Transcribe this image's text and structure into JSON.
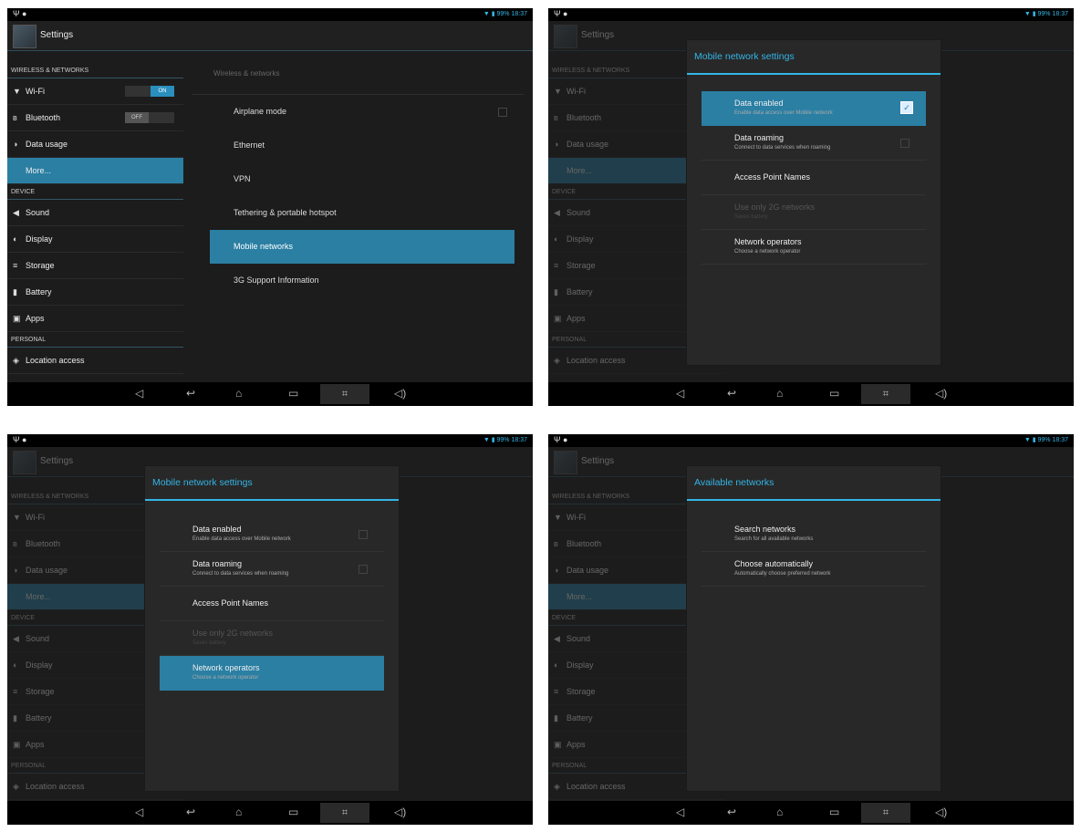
{
  "statusbar": {
    "left": "Ψ ●",
    "right": "▼ ▮ 99% 18:37"
  },
  "app_title": "Settings",
  "sidebar": {
    "cat_wireless": "WIRELESS & NETWORKS",
    "wifi": "Wi-Fi",
    "wifi_toggle": "ON",
    "bluetooth": "Bluetooth",
    "bluetooth_toggle": "OFF",
    "data_usage": "Data usage",
    "more": "More...",
    "cat_device": "DEVICE",
    "sound": "Sound",
    "display": "Display",
    "storage": "Storage",
    "battery": "Battery",
    "apps": "Apps",
    "cat_personal": "PERSONAL",
    "location": "Location access"
  },
  "wireless_panel": {
    "header": "Wireless & networks",
    "items": [
      "Airplane mode",
      "Ethernet",
      "VPN",
      "Tethering & portable hotspot",
      "Mobile networks",
      "3G Support Information"
    ]
  },
  "mobile_dialog": {
    "title": "Mobile network settings",
    "data_enabled": "Data enabled",
    "data_enabled_sub": "Enable data access over Mobile network",
    "data_roaming": "Data roaming",
    "data_roaming_sub": "Connect to data services when roaming",
    "apn": "Access Point Names",
    "use_2g": "Use only 2G networks",
    "use_2g_sub": "Saves battery",
    "operators": "Network operators",
    "operators_sub": "Choose a network operator"
  },
  "available_dialog": {
    "title": "Available networks",
    "search": "Search networks",
    "search_sub": "Search for all available networks",
    "auto": "Choose automatically",
    "auto_sub": "Automatically choose preferred network"
  },
  "icons": {
    "wifi": "wifi-icon",
    "bluetooth": "bluetooth-icon",
    "data": "data-usage-icon",
    "sound": "sound-icon",
    "display": "display-icon",
    "storage": "storage-icon",
    "battery": "battery-icon",
    "apps": "apps-icon",
    "location": "location-icon",
    "volume_down": "volume-down-icon",
    "back": "back-icon",
    "home": "home-icon",
    "recents": "recents-icon",
    "screenshot": "screenshot-icon",
    "volume_up": "volume-up-icon"
  },
  "colors": {
    "accent": "#33b5e5",
    "selected": "#2a7fa3",
    "background": "#1c1c1c"
  }
}
